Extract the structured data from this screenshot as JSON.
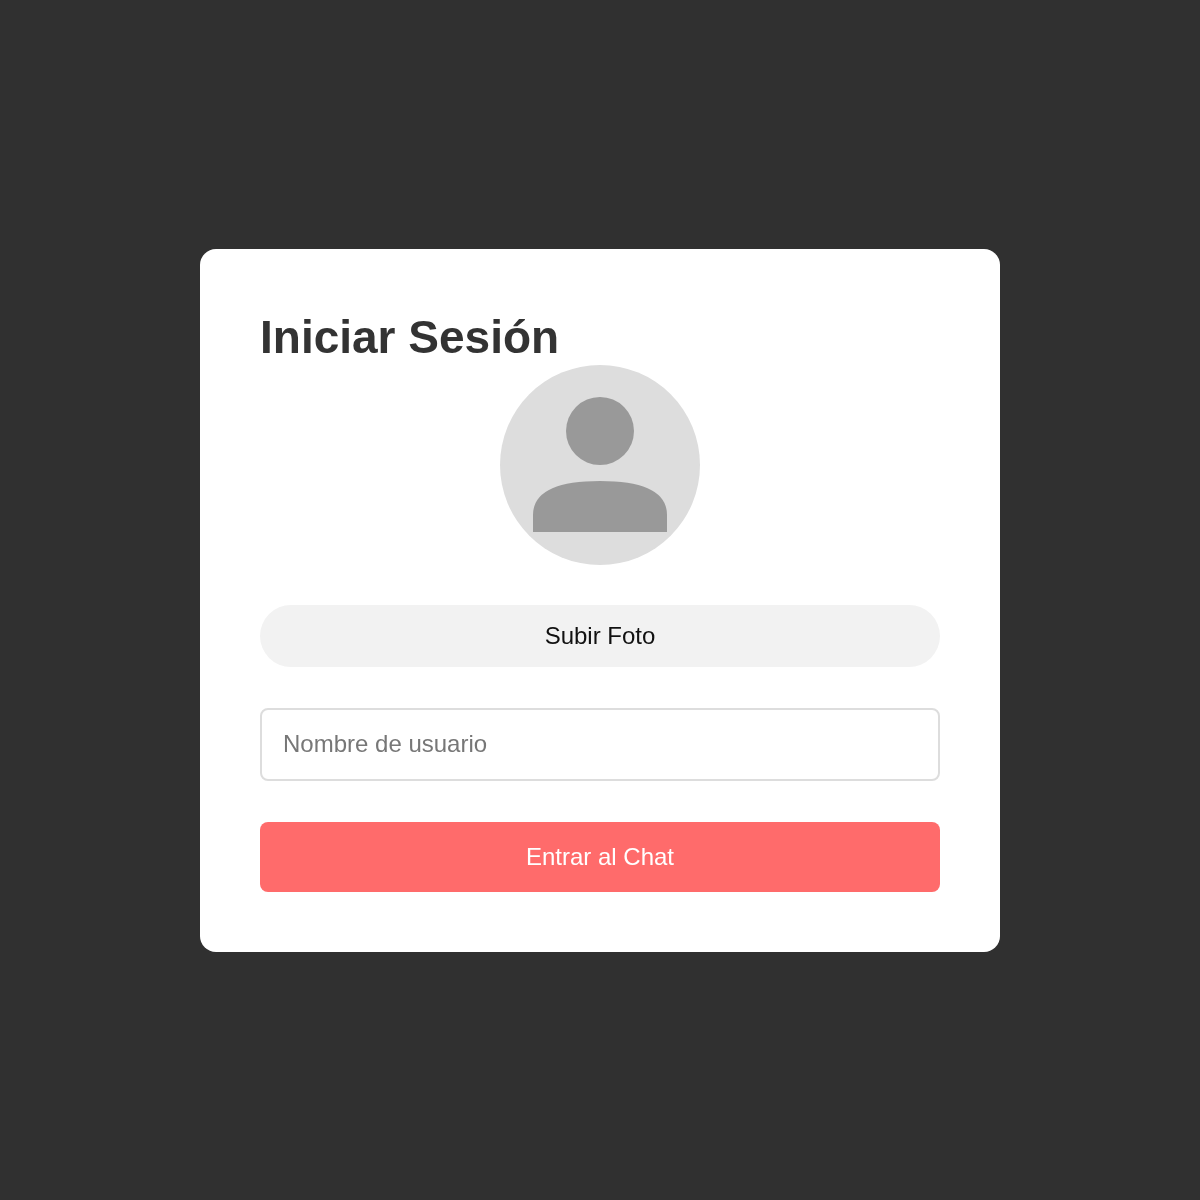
{
  "title": "Iniciar Sesión",
  "upload_button": "Subir Foto",
  "username": {
    "placeholder": "Nombre de usuario"
  },
  "submit_button": "Entrar al Chat"
}
